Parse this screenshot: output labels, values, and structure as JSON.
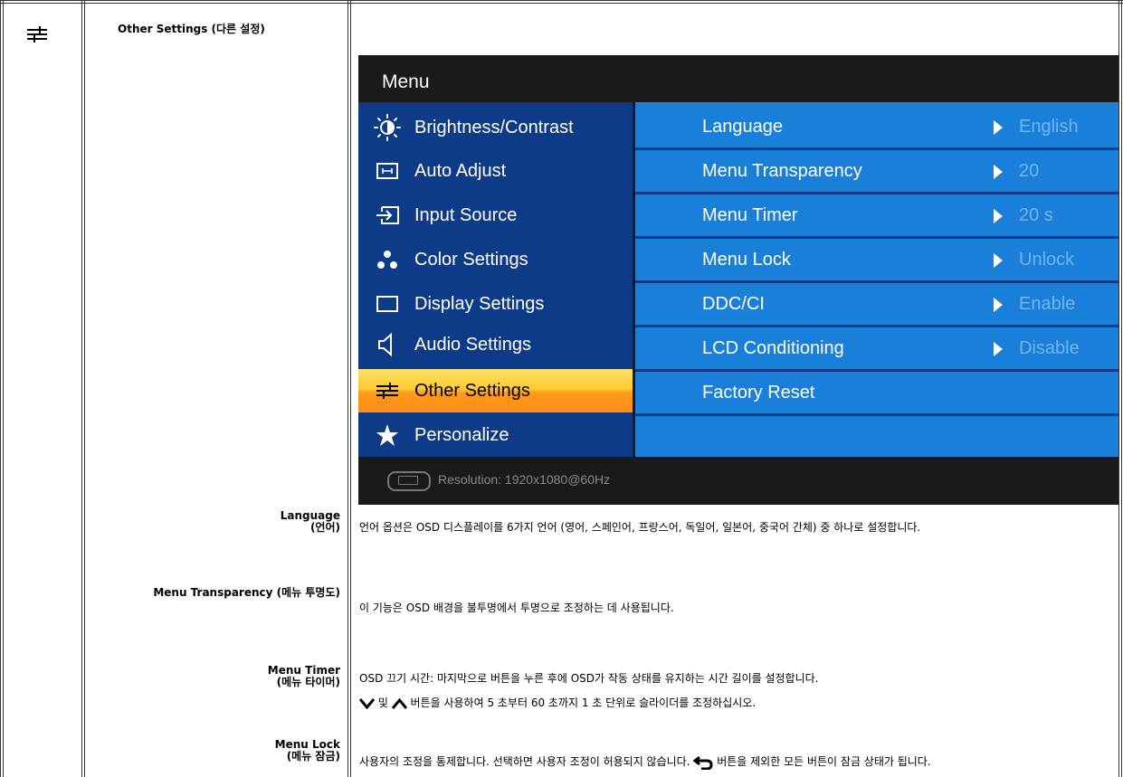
{
  "section": {
    "icon": "other-settings-icon",
    "title": "Other Settings (다른 설정)"
  },
  "osd": {
    "title": "Menu",
    "menu_items": [
      {
        "label": "Brightness/Contrast",
        "icon": "brightness-icon"
      },
      {
        "label": "Auto Adjust",
        "icon": "auto-adjust-icon"
      },
      {
        "label": "Input Source",
        "icon": "input-source-icon"
      },
      {
        "label": "Color Settings",
        "icon": "color-settings-icon"
      },
      {
        "label": "Display Settings",
        "icon": "display-settings-icon"
      },
      {
        "label": "Audio Settings",
        "icon": "audio-settings-icon"
      },
      {
        "label": "Other Settings",
        "icon": "other-settings-icon",
        "active": true
      },
      {
        "label": "Personalize",
        "icon": "star-icon"
      }
    ],
    "settings": [
      {
        "label": "Language",
        "value": "English"
      },
      {
        "label": "Menu Transparency",
        "value": "20"
      },
      {
        "label": "Menu Timer",
        "value": "20 s"
      },
      {
        "label": "Menu Lock",
        "value": "Unlock"
      },
      {
        "label": "DDC/CI",
        "value": "Enable"
      },
      {
        "label": "LCD Conditioning",
        "value": "Disable"
      },
      {
        "label": "Factory Reset",
        "value": ""
      }
    ],
    "footer": "Resolution:  1920x1080@60Hz",
    "colors": {
      "left_panel": "#0d3b88",
      "right_panel": "#1a7fd9",
      "active": "#ffaa22",
      "footer": "#1a1a1a"
    }
  },
  "items": [
    {
      "label_line1": "Language",
      "label_line2": "(언어)",
      "desc": "언어 옵션은 OSD 디스플레이를 6가지 언어 (영어, 스페인어, 프랑스어, 독일어, 일본어, 중국어 간체) 중 하나로 설정합니다."
    },
    {
      "label_line1": "Menu Transparency (메뉴 투명도)",
      "label_line2": "",
      "desc": "이 기능은 OSD 배경을 불투명에서 투명으로 조정하는 데 사용됩니다."
    },
    {
      "label_line1": "Menu Timer",
      "label_line2": "(메뉴 타이머)",
      "desc": "OSD 끄기 시간: 마지막으로 버튼을 누른 후에 OSD가 작동 상태를 유지하는 시간 길이를 설정합니다.",
      "desc2_mid": "및",
      "desc2_end": "버튼을 사용하여 5 초부터 60 초까지 1 초 단위로 슬라이더를 조정하십시오."
    },
    {
      "label_line1": "Menu Lock",
      "label_line2": "(메뉴 잠금)",
      "desc": "사용자의 조정을 통제합니다. 선택하면 사용자 조정이 허용되지 않습니다.",
      "desc_end": "버튼을 제외한 모든 버튼이 잠금 상태가 됩니다."
    }
  ]
}
